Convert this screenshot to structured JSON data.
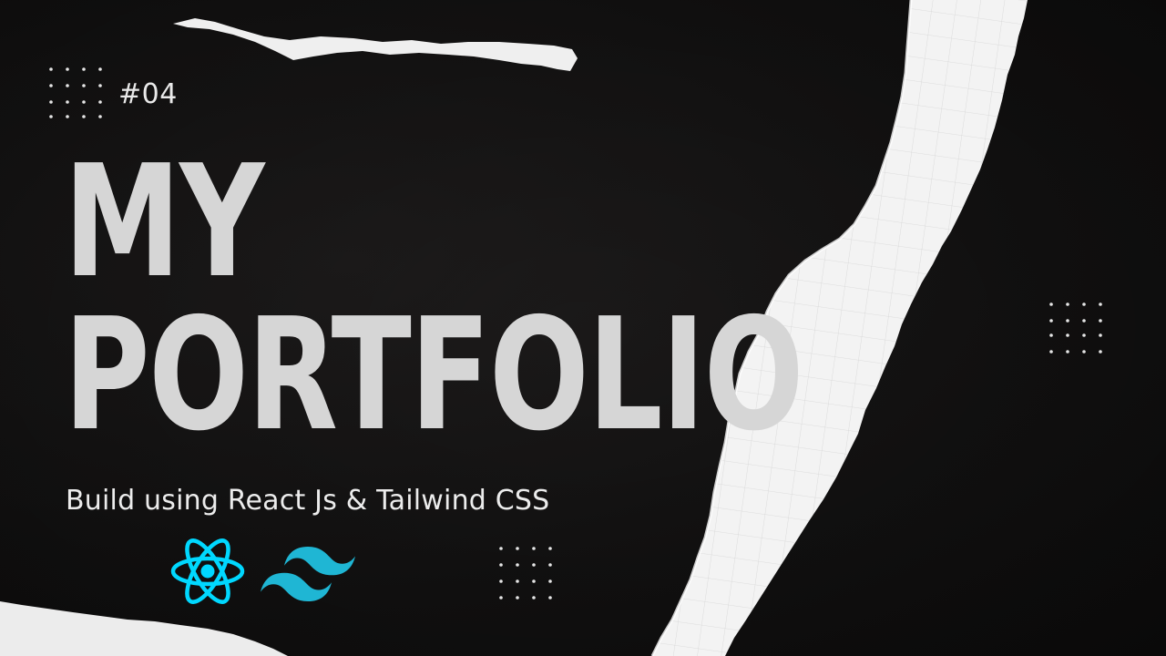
{
  "episode_tag": "#04",
  "title_lines": [
    "MY",
    "PORTFOLIO"
  ],
  "subtitle": "Build using React Js & Tailwind CSS",
  "logos": [
    {
      "icon": "react-logo-icon",
      "color": "#00d8ff"
    },
    {
      "icon": "tailwind-logo-icon",
      "color": "#1fb6d4"
    }
  ],
  "colors": {
    "background": "#151414",
    "title": "#d6d6d6",
    "text": "#ececec",
    "paper": "#f2f2f2"
  }
}
